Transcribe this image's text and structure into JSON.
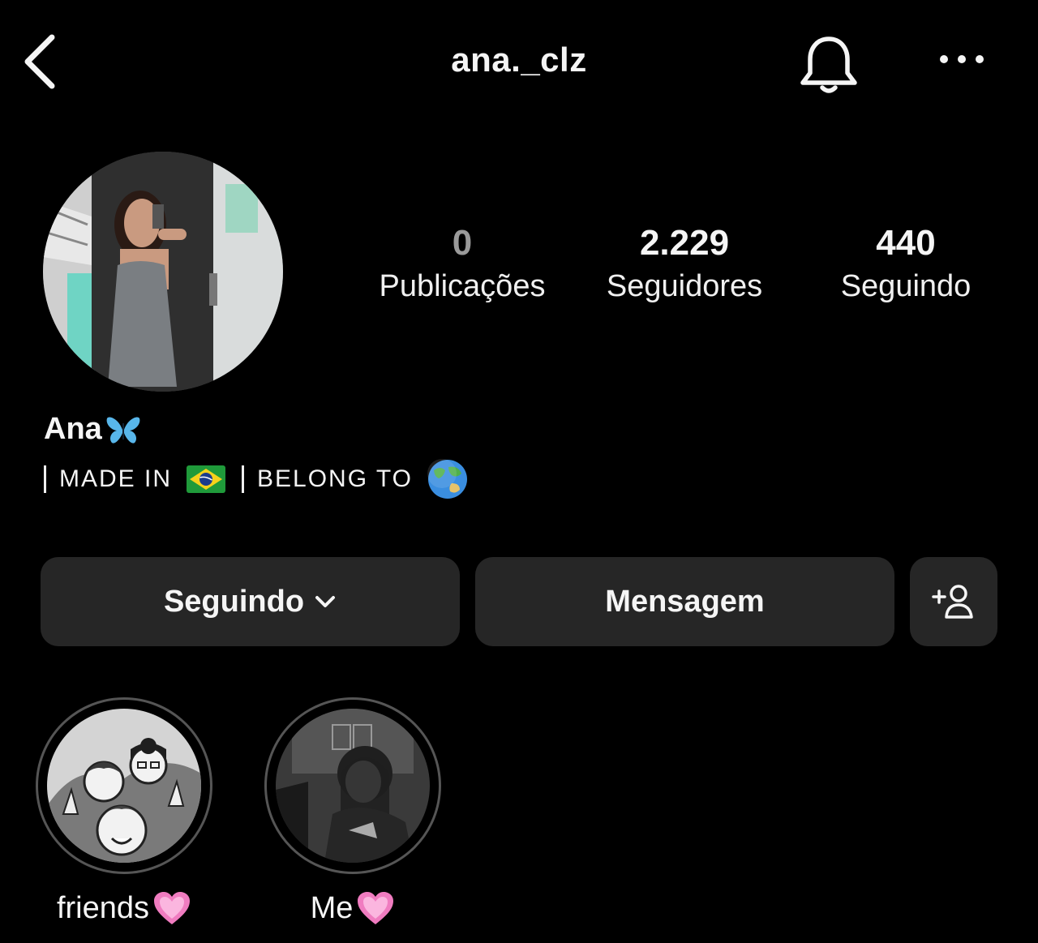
{
  "header": {
    "username": "ana._clz",
    "back_icon": "chevron-left-icon",
    "notification_icon": "bell-icon",
    "more_icon": "more-horizontal-icon"
  },
  "profile": {
    "display_name": "Ana",
    "name_emoji": "blue-butterfly-emoji",
    "bio_made_in": "MADE IN",
    "bio_flag": "brazil-flag-emoji",
    "bio_belong_to": "BELONG TO",
    "bio_globe": "globe-emoji"
  },
  "stats": [
    {
      "value": "0",
      "label": "Publicações"
    },
    {
      "value": "2.229",
      "label": "Seguidores"
    },
    {
      "value": "440",
      "label": "Seguindo"
    }
  ],
  "actions": {
    "follow_label": "Seguindo",
    "follow_icon": "chevron-down-icon",
    "message_label": "Mensagem",
    "add_person_icon": "add-person-icon"
  },
  "highlights": [
    {
      "label": "friends",
      "emoji": "pink-heart-emoji"
    },
    {
      "label": "Me",
      "emoji": "pink-heart-emoji"
    }
  ],
  "colors": {
    "background": "#000000",
    "button": "#262626",
    "text": "#f5f5f5",
    "muted": "#9a9a9a"
  }
}
